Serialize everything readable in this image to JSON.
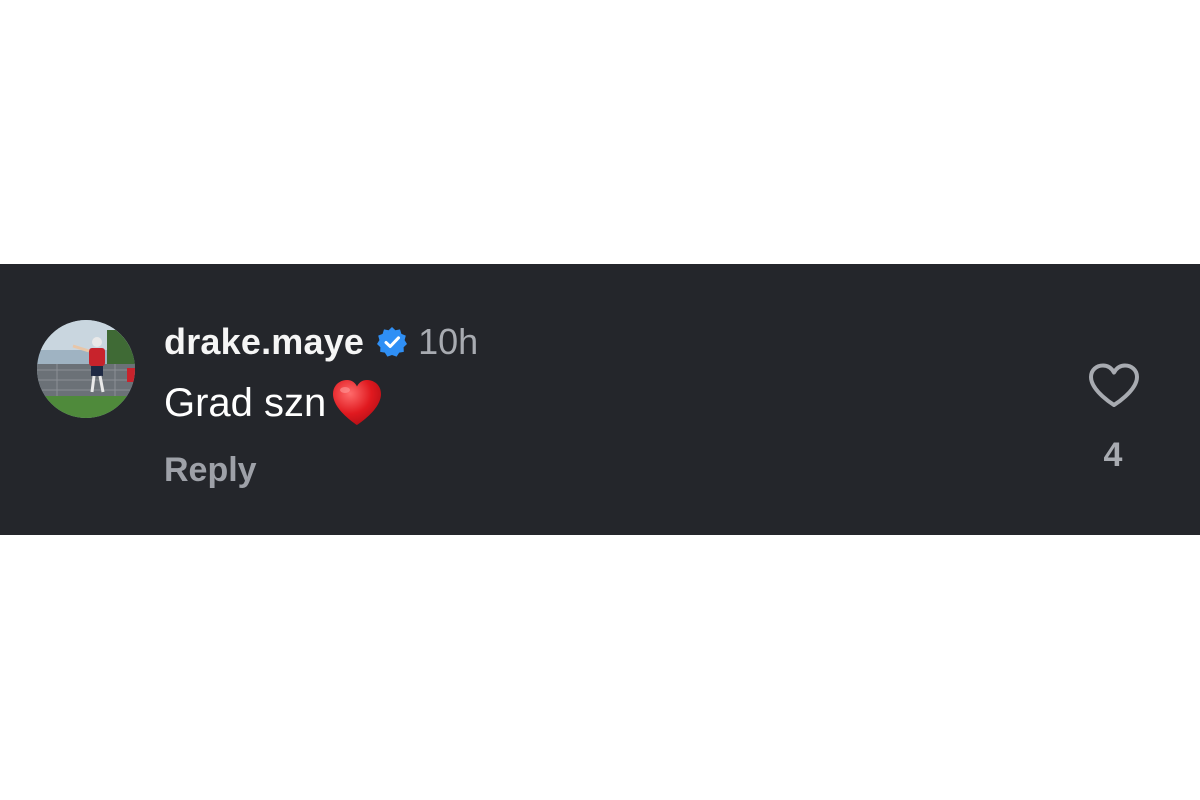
{
  "comment": {
    "avatar": {
      "icon": "profile-photo-football-player",
      "colors": {
        "sky": "#9fb3c2",
        "grass": "#4f8a3b",
        "jersey": "#c8232c",
        "fence": "#6b7177"
      }
    },
    "username": "drake.maye",
    "verified_icon": "verified-badge-icon",
    "timestamp": "10h",
    "text": "Grad szn",
    "emoji_icon": "red-heart-emoji",
    "reply_label": "Reply",
    "like_icon": "heart-outline-icon",
    "like_count": "4"
  },
  "colors": {
    "strip_background": "#24262b",
    "page_background": "#ffffff",
    "username": "#f5f5f5",
    "muted_text": "#a8abb1",
    "verified_blue": "#2f8ff5",
    "heart_red": "#e0191f"
  }
}
